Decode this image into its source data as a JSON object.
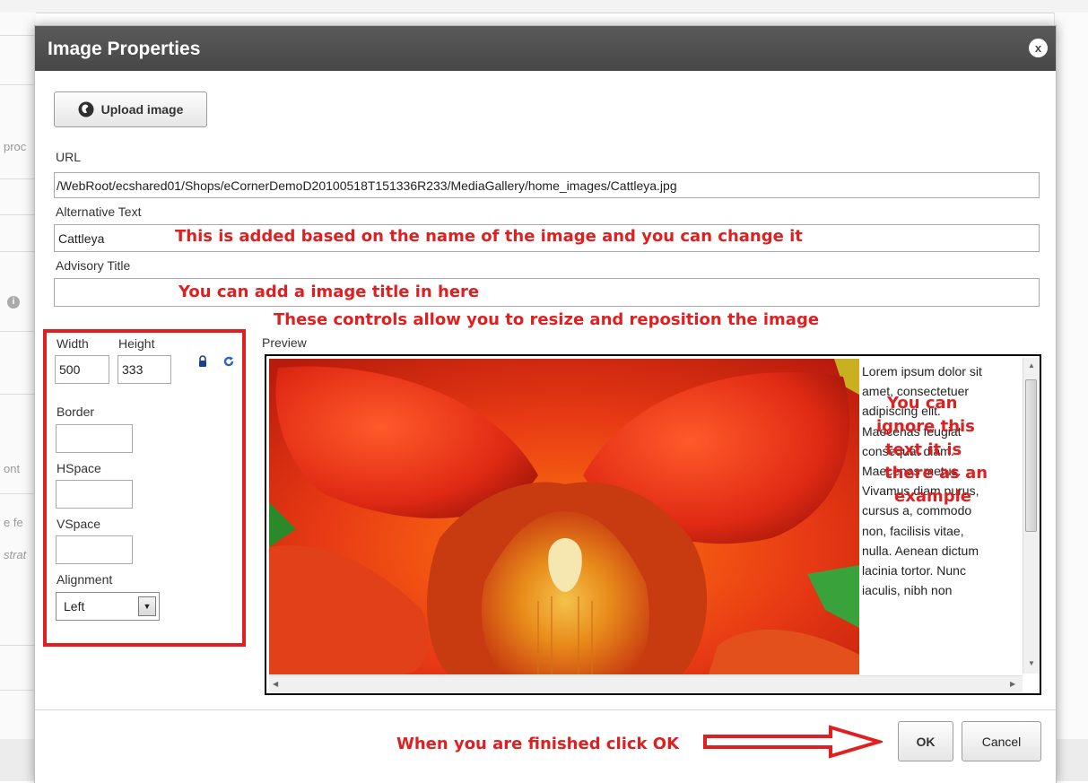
{
  "background": {
    "left_snippets": [
      "proc",
      "ont",
      "e fe",
      "strat"
    ]
  },
  "dialog": {
    "title": "Image Properties",
    "close_label": "x",
    "upload_label": "Upload image",
    "url_label": "URL",
    "url_value": "/WebRoot/ecshared01/Shops/eCornerDemoD20100518T151336R233/MediaGallery/home_images/Cattleya.jpg",
    "alt_label": "Alternative Text",
    "alt_value": "Cattleya",
    "title_label": "Advisory Title",
    "title_value": "",
    "width_label": "Width",
    "width_value": "500",
    "height_label": "Height",
    "height_value": "333",
    "border_label": "Border",
    "border_value": "",
    "hspace_label": "HSpace",
    "hspace_value": "",
    "vspace_label": "VSpace",
    "vspace_value": "",
    "alignment_label": "Alignment",
    "alignment_value": "Left",
    "preview_label": "Preview",
    "preview_text": "Lorem ipsum dolor sit amet, consectetuer adipiscing elit. Maecenas feugiat consequat diam. Maecenas metus. Vivamus diam purus, cursus a, commodo non, facilisis vitae, nulla. Aenean dictum lacinia tortor. Nunc iaculis, nibh non",
    "ok_label": "OK",
    "cancel_label": "Cancel"
  },
  "annotations": {
    "alt_note": "This is added based on the name of the image and you can change it",
    "title_note": "You can add a image title in here",
    "controls_note": "These controls allow you to resize and reposition the image",
    "preview_note_1": "You can",
    "preview_note_2": "ignore this",
    "preview_note_3": "text it is",
    "preview_note_4": "there as an",
    "preview_note_5": "example",
    "ok_note": "When you are finished click OK"
  },
  "colors": {
    "annotation_red": "#e02020",
    "header_bg": "#4f4f4f"
  },
  "icons": {
    "upload": "upload-globe-icon",
    "lock": "lock-icon",
    "reset": "reset-size-icon",
    "close": "close-icon",
    "dropdown": "chevron-down-icon",
    "arrow": "right-arrow-icon"
  }
}
